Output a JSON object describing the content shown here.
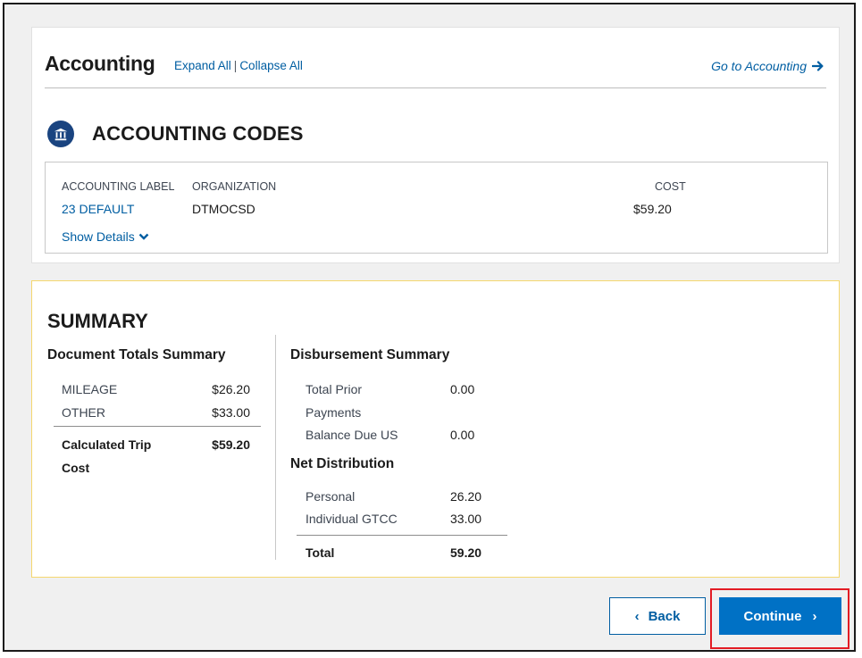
{
  "accounting": {
    "title": "Accounting",
    "expand_all": "Expand All",
    "separator": "|",
    "collapse_all": "Collapse All",
    "go_to": "Go to Accounting"
  },
  "codes": {
    "title": "ACCOUNTING CODES",
    "columns": {
      "label": "ACCOUNTING LABEL",
      "organization": "ORGANIZATION",
      "cost": "COST"
    },
    "row": {
      "label": "23 DEFAULT",
      "organization": "DTMOCSD",
      "cost": "$59.20"
    },
    "show_details": "Show Details"
  },
  "summary": {
    "title": "SUMMARY",
    "document_totals": {
      "heading": "Document Totals Summary",
      "items": [
        {
          "label": "MILEAGE",
          "value": "$26.20"
        },
        {
          "label": "OTHER",
          "value": "$33.00"
        }
      ],
      "total_label_line1": "Calculated Trip",
      "total_label_line2": "Cost",
      "total_value": "$59.20"
    },
    "disbursement": {
      "heading": "Disbursement Summary",
      "prior_label_line1": "Total Prior",
      "prior_label_line2": "Payments",
      "prior_value": "0.00",
      "balance_label": "Balance Due US",
      "balance_value": "0.00"
    },
    "net_distribution": {
      "heading": "Net Distribution",
      "items": [
        {
          "label": "Personal",
          "value": "26.20"
        },
        {
          "label": "Individual GTCC",
          "value": "33.00"
        }
      ],
      "total_label": "Total",
      "total_value": "59.20"
    }
  },
  "buttons": {
    "back": "Back",
    "continue": "Continue"
  },
  "colors": {
    "link": "#005ea2",
    "primary": "#0071c5",
    "highlight": "#e31c24",
    "summary_border": "#f5d76e"
  }
}
